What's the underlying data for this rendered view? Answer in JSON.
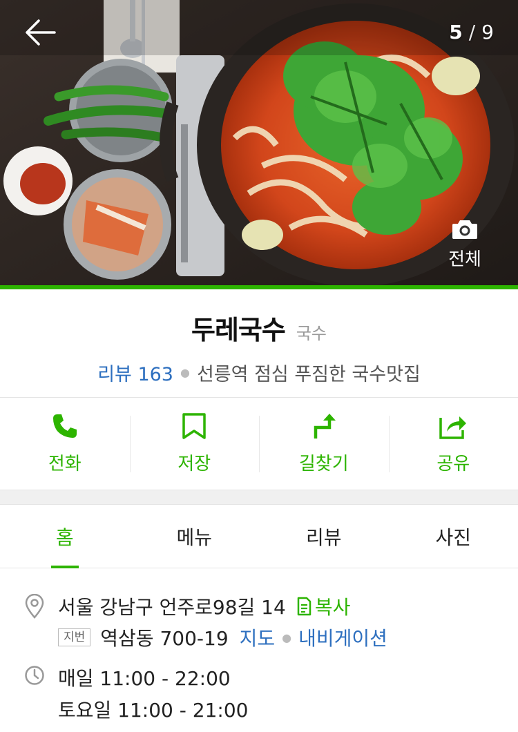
{
  "hero": {
    "photo_index": "5",
    "photo_total": "9",
    "all_photos_label": "전체"
  },
  "place": {
    "name": "두레국수",
    "category": "국수",
    "review_label": "리뷰 163",
    "description": "선릉역 점심 푸짐한 국수맛집"
  },
  "actions": [
    {
      "label": "전화",
      "icon": "phone-icon"
    },
    {
      "label": "저장",
      "icon": "bookmark-icon"
    },
    {
      "label": "길찾기",
      "icon": "directions-icon"
    },
    {
      "label": "공유",
      "icon": "share-icon"
    }
  ],
  "tabs": [
    {
      "label": "홈",
      "active": true
    },
    {
      "label": "메뉴",
      "active": false
    },
    {
      "label": "리뷰",
      "active": false
    },
    {
      "label": "사진",
      "active": false
    }
  ],
  "info": {
    "address": "서울 강남구 언주로98길 14",
    "copy_label": "복사",
    "jibun_badge": "지번",
    "jibun_address": "역삼동 700-19",
    "map_link": "지도",
    "navigation_link": "내비게이션",
    "hours_daily": "매일 11:00 - 22:00",
    "hours_saturday": "토요일 11:00 - 21:00"
  },
  "colors": {
    "accent_green": "#2db400",
    "link_blue": "#2d6fbf"
  }
}
